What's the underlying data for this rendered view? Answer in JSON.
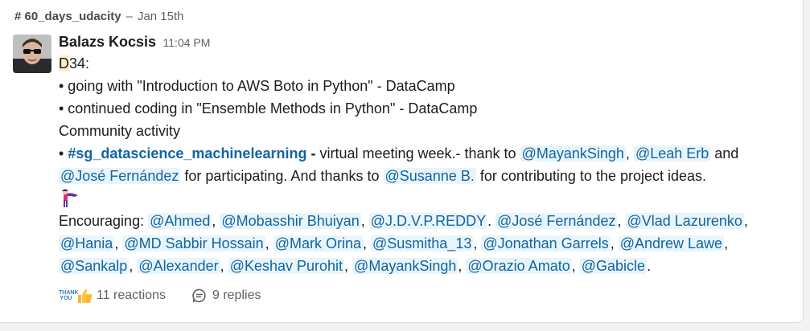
{
  "header": {
    "channel": "# 60_days_udacity",
    "separator": "–",
    "date": "Jan 15th"
  },
  "message": {
    "author": "Balazs Kocsis",
    "time": "11:04 PM",
    "day_prefix": "D",
    "day_number": "34:",
    "bullet1": "• going with \"Introduction to AWS Boto in Python\" - DataCamp",
    "bullet2": "• continued coding in \"Ensemble Methods in Python\" - DataCamp",
    "community": "Community activity",
    "bullet3": {
      "bullet": "• ",
      "channel": "#sg_datascience_machinelearning",
      "dash": " - ",
      "text_a": "virtual meeting week.- thank to ",
      "mention1": "@MayankSingh",
      "comma": ", ",
      "mention2": "@Leah Erb",
      "and": " and"
    },
    "line_cont": {
      "mention1": "@José Fernández",
      "text_a": " for participating. And thanks to ",
      "mention2": "@Susanne B.",
      "text_b": " for contributing to the project ideas."
    },
    "encouraging_label": "Encouraging: ",
    "encouraging_line1": [
      "@Ahmed",
      "@Mobasshir Bhuiyan",
      "@J.D.V.P.REDDY"
    ],
    "encouraging_line1b": [
      "@José Fernández",
      "@Vlad Lazurenko"
    ],
    "encouraging_line2": [
      "@Hania",
      "@MD Sabbir Hossain",
      "@Mark Orina",
      "@Susmitha_13",
      "@Jonathan Garrels",
      "@Andrew Lawe"
    ],
    "encouraging_line3": [
      "@Sankalp",
      "@Alexander",
      "@Keshav Purohit",
      "@MayankSingh",
      "@Orazio Amato",
      "@Gabicle"
    ]
  },
  "footer": {
    "thanks_icon_text": "THANK YOU",
    "reactions": "11 reactions",
    "replies": "9 replies"
  },
  "icons": {
    "avatar": "user-avatar-sunglasses",
    "superhero": "superhero-emoji",
    "thumb": "thumbs-up-emoji",
    "thanks": "thank-you-sticker-emoji",
    "replies": "speech-bubble-icon"
  },
  "colors": {
    "mention_bg": "#e8f5fa",
    "mention_fg": "#1264a3",
    "highlight": "#fcefc7"
  }
}
